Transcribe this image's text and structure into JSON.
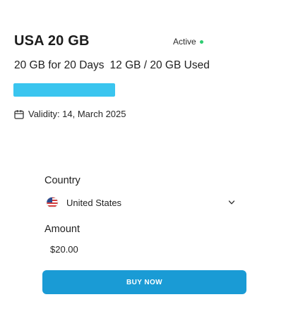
{
  "plan": {
    "title": "USA 20 GB",
    "status": "Active",
    "status_color": "#2ecc71",
    "package": "20 GB for 20 Days",
    "usage": "12 GB / 20 GB Used",
    "usage_fraction": 1.0,
    "usage_color": "#3ac5ef",
    "validity": "Validity: 14, March 2025",
    "calendar_icon": "calendar-icon"
  },
  "form": {
    "country_label": "Country",
    "country_value": "United States",
    "country_flag_icon": "us-flag-icon",
    "dropdown_icon": "chevron-down-icon",
    "amount_label": "Amount",
    "amount_value": "$20.00"
  },
  "action": {
    "buy_label": "BUY NOW",
    "button_color": "#1a9bd5"
  }
}
